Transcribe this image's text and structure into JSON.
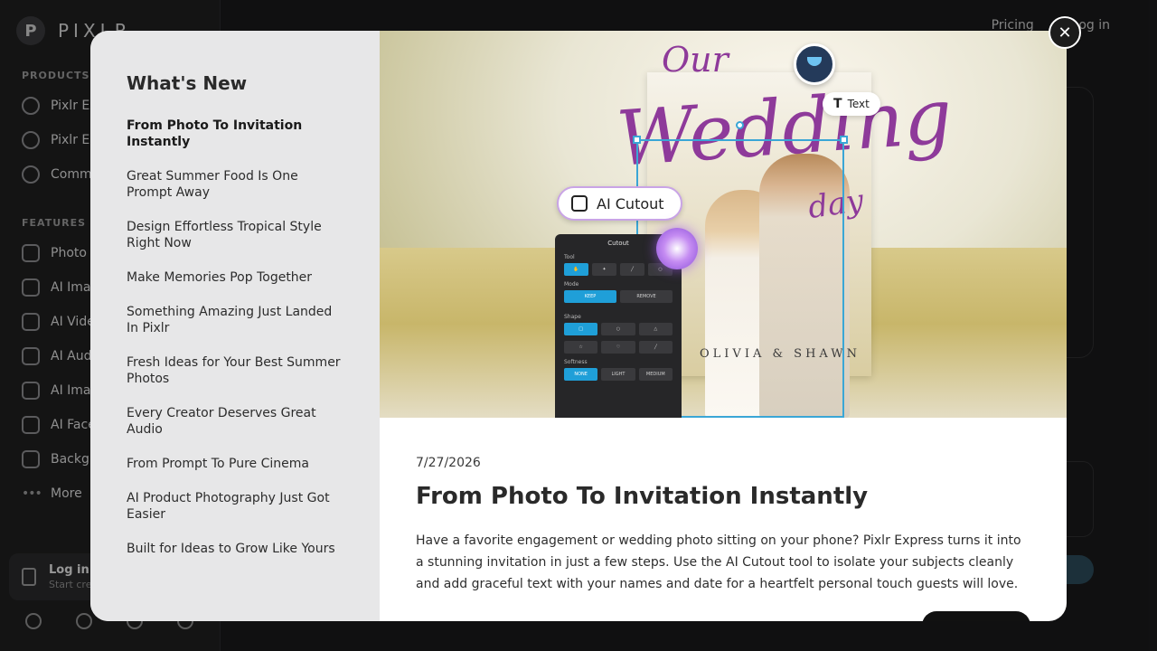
{
  "app": {
    "logo_text": "PIXLR",
    "logo_mark": "P",
    "top_nav": [
      "Pricing",
      "Log in"
    ]
  },
  "sidebar": {
    "products_title": "PRODUCTS",
    "products": [
      "Pixlr Ex",
      "Pixlr Ed",
      "Comm"
    ],
    "features_title": "FEATURES",
    "features": [
      "Photo E",
      "AI Imag",
      "AI Vide",
      "AI Aud",
      "AI Imag",
      "AI Face",
      "Backgr",
      "More"
    ],
    "login_title": "Log in",
    "login_sub": "Start cre"
  },
  "modal": {
    "heading": "What's New",
    "articles": [
      "From Photo To Invitation Instantly",
      "Great Summer Food Is One Prompt Away",
      "Design Effortless Tropical Style Right Now",
      "Make Memories Pop Together",
      "Something Amazing Just Landed In Pixlr",
      "Fresh Ideas for Your Best Summer Photos",
      "Every Creator Deserves Great Audio",
      "From Prompt To Pure Cinema",
      "AI Product Photography Just Got Easier",
      "Built for Ideas to Grow Like Yours"
    ],
    "active_index": 0,
    "hero": {
      "script_line1": "Our",
      "script_line2": "Wedding",
      "script_line3": "day",
      "names": "OLIVIA & SHAWN",
      "ai_cutout_label": "AI Cutout",
      "text_label": "Text",
      "panel": {
        "title": "Cutout",
        "tool_label": "Tool",
        "mode_label": "Mode",
        "mode_keep": "KEEP",
        "mode_remove": "REMOVE",
        "shape_label": "Shape",
        "softness_label": "Softness",
        "soft_none": "NONE",
        "soft_light": "LIGHT",
        "soft_medium": "MEDIUM"
      }
    },
    "article": {
      "date": "7/27/2026",
      "title": "From Photo To Invitation Instantly",
      "body": "Have a favorite engagement or wedding photo sitting on your phone? Pixlr Express turns it into a stunning invitation in just a few steps. Use the AI Cutout tool to isolate your subjects cleanly and add graceful text with your names and date for a heartfelt personal touch guests will love."
    },
    "close_symbol": "✕"
  }
}
